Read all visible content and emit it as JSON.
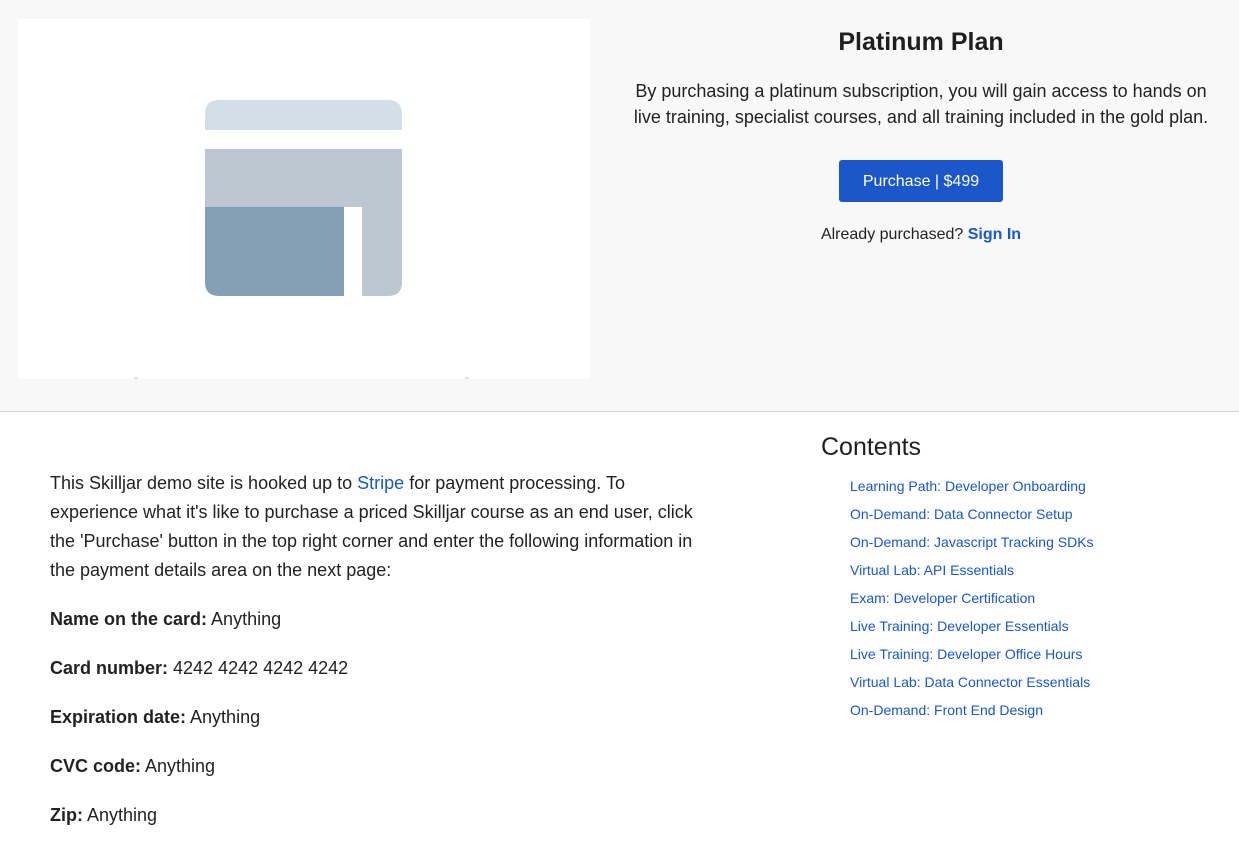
{
  "hero": {
    "logo_icon": "skilljar-logo-icon",
    "plan_title": "Platinum Plan",
    "plan_description": "By purchasing a platinum subscription, you will gain access to hands on live training, specialist courses, and all training included in the gold plan.",
    "purchase_label": "Purchase | $499",
    "already_purchased_text": "Already purchased? ",
    "sign_in_label": "Sign In"
  },
  "description": {
    "intro_before_link": "This Skilljar demo site is hooked up to ",
    "stripe_link": "Stripe",
    "intro_after_link": " for payment processing. To experience what it's like to purchase a priced Skilljar course as an end user, click the 'Purchase' button in the top right corner and enter the following information in the payment details area on the next page:",
    "fields": [
      {
        "label": "Name on the card:",
        "value": " Anything"
      },
      {
        "label": "Card number:",
        "value": " 4242 4242 4242 4242"
      },
      {
        "label": "Expiration date:",
        "value": " Anything"
      },
      {
        "label": "CVC code:",
        "value": " Anything"
      },
      {
        "label": "Zip:",
        "value": " Anything"
      }
    ]
  },
  "contents": {
    "title": "Contents",
    "items": [
      {
        "label": "Learning Path: Developer Onboarding"
      },
      {
        "label": "On-Demand: Data Connector Setup"
      },
      {
        "label": "On-Demand: Javascript Tracking SDKs"
      },
      {
        "label": "Virtual Lab: API Essentials"
      },
      {
        "label": "Exam: Developer Certification"
      },
      {
        "label": "Live Training: Developer Essentials"
      },
      {
        "label": "Live Training: Developer Office Hours"
      },
      {
        "label": "Virtual Lab: Data Connector Essentials"
      },
      {
        "label": "On-Demand: Front End Design"
      }
    ]
  },
  "colors": {
    "link": "#1b57c8",
    "button": "#1b57c8",
    "hero_background": "#f8f8f8",
    "logo_light": "#d3dfe8",
    "logo_mid": "#bcc7d2",
    "logo_dark": "#859fb4"
  }
}
